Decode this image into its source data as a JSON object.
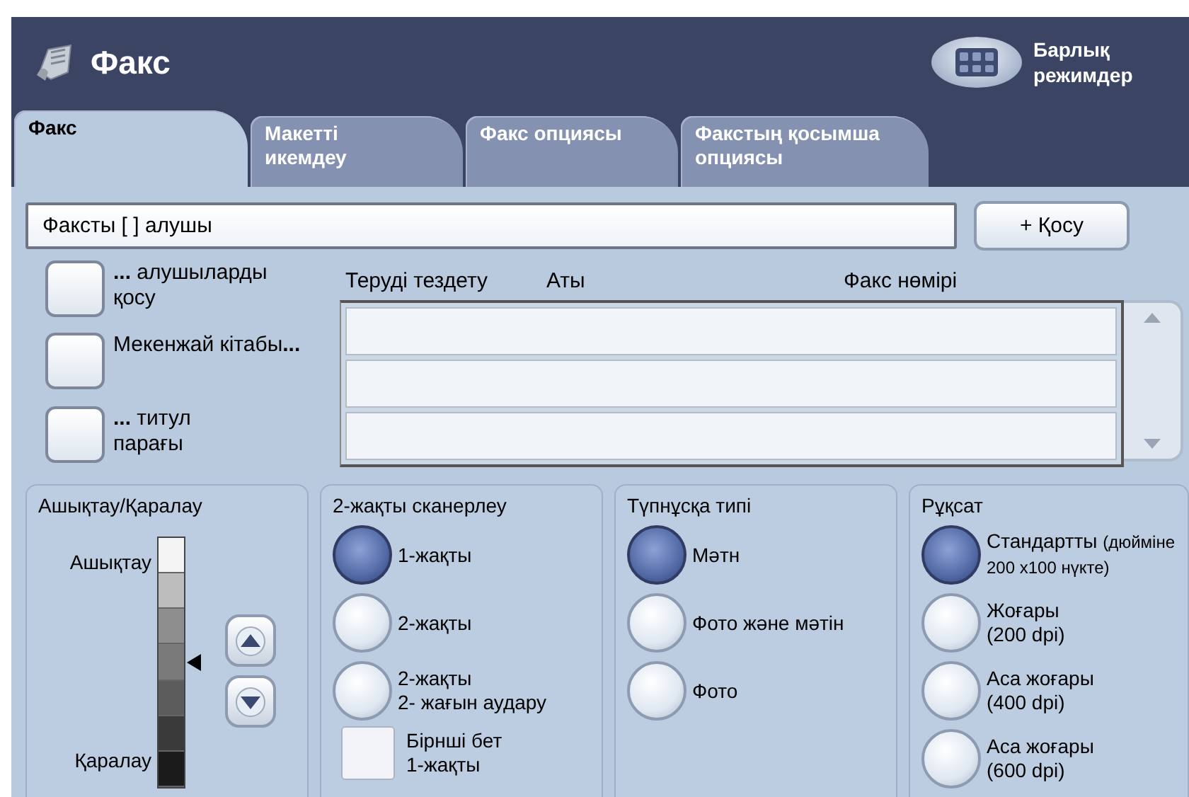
{
  "header": {
    "title": "Факс",
    "all_modes": [
      "Барлық",
      "режимдер"
    ]
  },
  "tabs": [
    {
      "lines": [
        "Факс"
      ],
      "selected": true
    },
    {
      "lines": [
        "Макетті",
        "икемдеу"
      ],
      "selected": false
    },
    {
      "lines": [
        "Факс опциясы"
      ],
      "selected": false
    },
    {
      "lines": [
        "Факстың қосымша",
        "опциясы"
      ],
      "selected": false
    }
  ],
  "recipient": {
    "value": "Факсты [ ] алушы",
    "add_button": "+ Қосу"
  },
  "actions": [
    {
      "lines": [
        "**...** алушыларды",
        "қосу"
      ]
    },
    {
      "lines": [
        "Мекенжай кітабы**...**"
      ]
    },
    {
      "lines": [
        "**...** титул",
        "парағы"
      ]
    }
  ],
  "table": {
    "columns": [
      "Теруді тездету",
      "Аты",
      "Факс нөмірі"
    ]
  },
  "density": {
    "title": "Ашықтау/Қаралау",
    "light_label": "Ашықтау",
    "dark_label": "Қаралау",
    "level": 0.5
  },
  "panels": [
    {
      "title": "2-жақты сканерлеу",
      "options": [
        {
          "kind": "radio",
          "lines": [
            "1-жақты"
          ],
          "selected": true
        },
        {
          "kind": "radio",
          "lines": [
            "2-жақты"
          ],
          "selected": false
        },
        {
          "kind": "radio",
          "lines": [
            "2-жақты",
            "2- жағын аудару"
          ],
          "selected": false
        },
        {
          "kind": "checkbox",
          "lines": [
            "Бірнші бет",
            "1-жақты"
          ],
          "checked": false
        }
      ]
    },
    {
      "title": "Түпнұсқа типі",
      "options": [
        {
          "kind": "radio",
          "lines": [
            "Мәтн"
          ],
          "selected": true
        },
        {
          "kind": "radio",
          "lines": [
            "Фото және мәтін"
          ],
          "selected": false
        },
        {
          "kind": "radio",
          "lines": [
            "Фото"
          ],
          "selected": false
        }
      ]
    },
    {
      "title": "Рұқсат",
      "options": [
        {
          "kind": "radio",
          "lines": [
            "Стандартты"
          ],
          "note": [
            "(дюйміне",
            "200 x100 нүкте)"
          ],
          "selected": true
        },
        {
          "kind": "radio",
          "lines": [
            "Жоғары",
            "(200 dpi)"
          ],
          "selected": false
        },
        {
          "kind": "radio",
          "lines": [
            "Аса жоғары",
            "(400 dpi)"
          ],
          "selected": false
        },
        {
          "kind": "radio",
          "lines": [
            "Аса жоғары",
            "(600 dpi)"
          ],
          "selected": false
        }
      ]
    }
  ]
}
